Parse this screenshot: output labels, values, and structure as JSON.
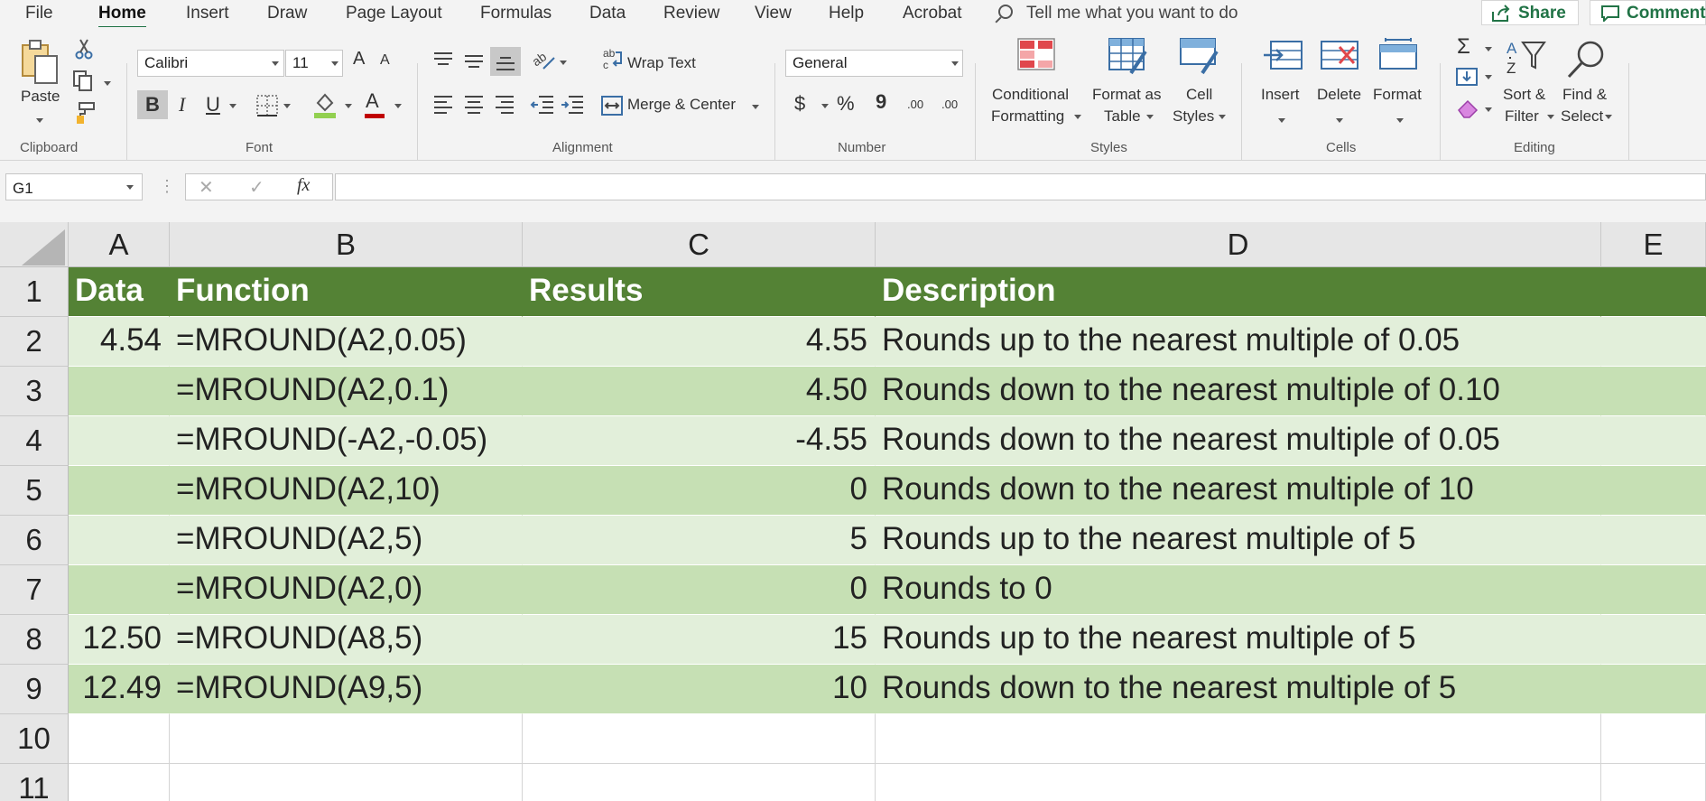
{
  "tabs": [
    "File",
    "Home",
    "Insert",
    "Draw",
    "Page Layout",
    "Formulas",
    "Data",
    "Review",
    "View",
    "Help",
    "Acrobat"
  ],
  "active_tab": "Home",
  "tell_me": "Tell me what you want to do",
  "share_label": "Share",
  "comments_label": "Comments",
  "ribbon": {
    "clipboard": {
      "group": "Clipboard",
      "paste": "Paste"
    },
    "font": {
      "group": "Font",
      "name": "Calibri",
      "size": "11",
      "bold": "B",
      "italic": "I",
      "underline": "U",
      "grow": "A",
      "shrink": "A",
      "color_letter": "A"
    },
    "alignment": {
      "group": "Alignment",
      "wrap_text": "Wrap Text",
      "merge_center": "Merge & Center"
    },
    "number": {
      "group": "Number",
      "format": "General",
      "currency": "$",
      "percent": "%",
      "comma": "9",
      "inc_decimal": ".00",
      "dec_decimal": ".00"
    },
    "styles": {
      "group": "Styles",
      "conditional": [
        "Conditional",
        "Formatting"
      ],
      "format_table": [
        "Format as",
        "Table"
      ],
      "cell_styles": [
        "Cell",
        "Styles"
      ]
    },
    "cells": {
      "group": "Cells",
      "insert": "Insert",
      "delete": "Delete",
      "format": "Format"
    },
    "editing": {
      "group": "Editing",
      "sort": [
        "Sort &",
        "Filter"
      ],
      "find": [
        "Find &",
        "Select"
      ]
    }
  },
  "formula_bar": {
    "name_box": "G1",
    "cancel": "✕",
    "enter": "✓",
    "fx": "fx",
    "value": ""
  },
  "columns": [
    "A",
    "B",
    "C",
    "D",
    "E"
  ],
  "rows": [
    "1",
    "2",
    "3",
    "4",
    "5",
    "6",
    "7",
    "8",
    "9",
    "10",
    "11"
  ],
  "table": {
    "header": {
      "a": "Data",
      "b": "Function",
      "c": "Results",
      "d": "Description"
    },
    "rows": [
      {
        "a": "4.54",
        "b": "=MROUND(A2,0.05)",
        "c": "4.55",
        "d": "Rounds up to the nearest multiple of 0.05"
      },
      {
        "a": "",
        "b": "=MROUND(A2,0.1)",
        "c": "4.50",
        "d": "Rounds down to the nearest multiple of 0.10"
      },
      {
        "a": "",
        "b": "=MROUND(-A2,-0.05)",
        "c": "-4.55",
        "d": "Rounds down to the nearest multiple of 0.05"
      },
      {
        "a": "",
        "b": "=MROUND(A2,10)",
        "c": "0",
        "d": "Rounds down to the nearest multiple of 10"
      },
      {
        "a": "",
        "b": "=MROUND(A2,5)",
        "c": "5",
        "d": "Rounds up to the nearest multiple of 5"
      },
      {
        "a": "",
        "b": "=MROUND(A2,0)",
        "c": "0",
        "d": "Rounds to 0"
      },
      {
        "a": "12.50",
        "b": "=MROUND(A8,5)",
        "c": "15",
        "d": "Rounds up to the nearest multiple of 5"
      },
      {
        "a": "12.49",
        "b": "=MROUND(A9,5)",
        "c": "10",
        "d": "Rounds down to the nearest multiple of 5"
      }
    ]
  },
  "colors": {
    "header_fill": "#548235",
    "band_light": "#e2efda",
    "band_dark": "#c6e0b4",
    "accent": "#217346"
  }
}
